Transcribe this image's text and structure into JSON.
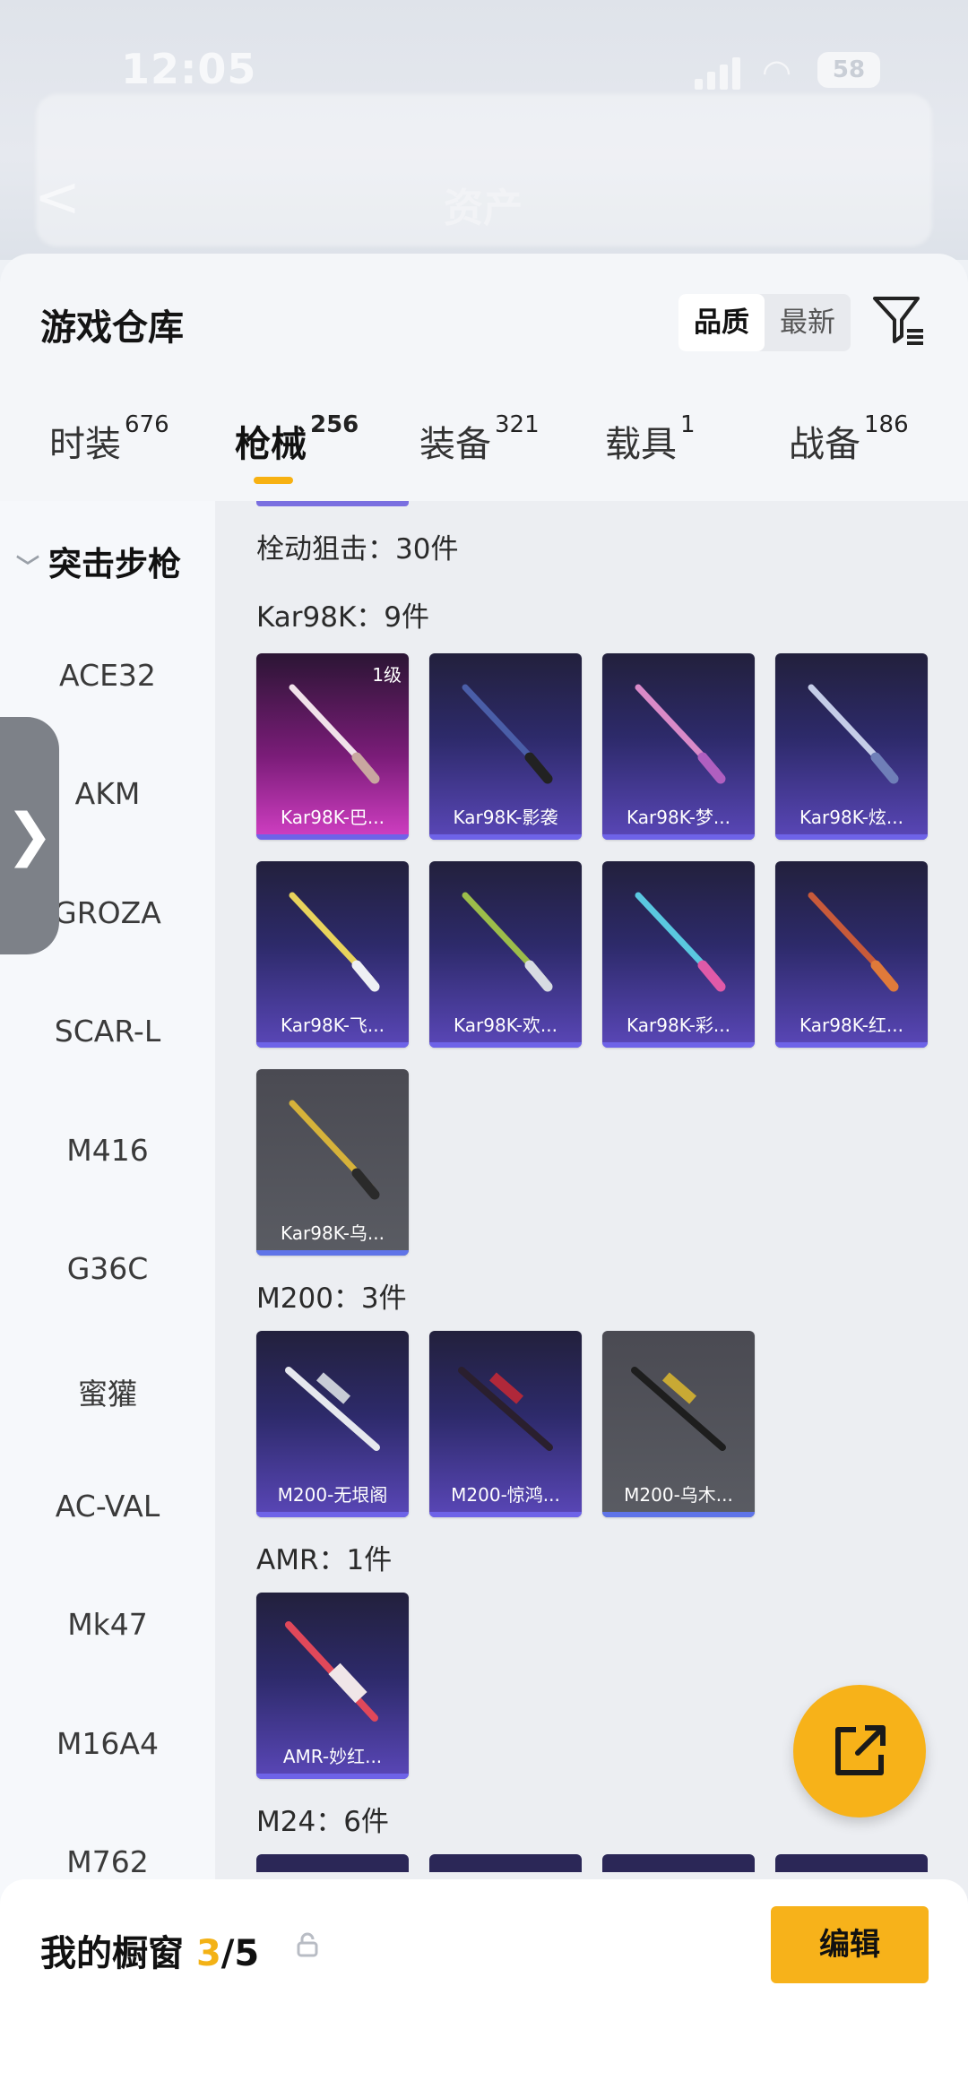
{
  "status": {
    "time": "12:05",
    "battery": "58"
  },
  "nav": {
    "title": "资产",
    "back_glyph": "<"
  },
  "header": {
    "title": "游戏仓库",
    "sort_quality": "品质",
    "sort_latest": "最新"
  },
  "tabs": [
    {
      "label": "时装",
      "count": "676"
    },
    {
      "label": "枪械",
      "count": "256"
    },
    {
      "label": "装备",
      "count": "321"
    },
    {
      "label": "载具",
      "count": "1"
    },
    {
      "label": "战备",
      "count": "186"
    }
  ],
  "sidebar": {
    "category": "突击步枪",
    "items": [
      "ACE32",
      "AKM",
      "GROZA",
      "SCAR-L",
      "M416",
      "G36C",
      "蜜獾",
      "AC-VAL",
      "Mk47",
      "M16A4",
      "M762"
    ],
    "handle_glyph": "❯"
  },
  "content": {
    "group_title": "栓动狙击：30件",
    "sections": [
      {
        "title": "Kar98K：9件",
        "items": [
          {
            "name": "Kar98K-巴...",
            "level": "1级"
          },
          {
            "name": "Kar98K-影袭"
          },
          {
            "name": "Kar98K-梦..."
          },
          {
            "name": "Kar98K-炫..."
          },
          {
            "name": "Kar98K-飞..."
          },
          {
            "name": "Kar98K-欢..."
          },
          {
            "name": "Kar98K-彩..."
          },
          {
            "name": "Kar98K-红..."
          },
          {
            "name": "Kar98K-乌..."
          }
        ]
      },
      {
        "title": "M200：3件",
        "items": [
          {
            "name": "M200-无垠阁"
          },
          {
            "name": "M200-惊鸿..."
          },
          {
            "name": "M200-乌木..."
          }
        ]
      },
      {
        "title": "AMR：1件",
        "items": [
          {
            "name": "AMR-妙红..."
          }
        ]
      },
      {
        "title": "M24：6件",
        "items": []
      }
    ]
  },
  "bottom": {
    "label": "我的橱窗",
    "current": "3",
    "total": "/5",
    "edit_label": "编辑"
  },
  "colors": {
    "accent": "#f7b21a",
    "card_purple": "#5a47b8",
    "card_pink": "#d23fc4",
    "card_gray": "#5a5c63"
  }
}
